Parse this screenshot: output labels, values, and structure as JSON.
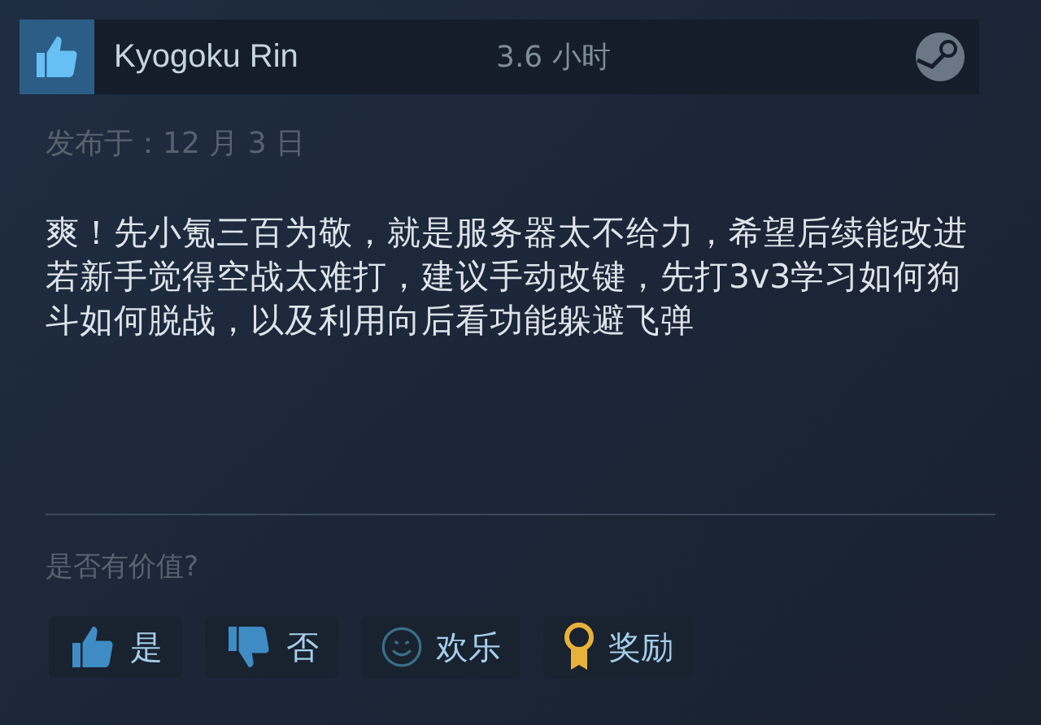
{
  "review": {
    "recommended": true,
    "author": "Kyogoku Rin",
    "playtime": "3.6 小时",
    "posted": "发布于：12 月 3 日",
    "paragraphs": [
      "爽！先小氪三百为敬，就是服务器太不给力，希望后续能改进",
      "若新手觉得空战太难打，建议手动改键，先打3v3学习如何狗斗如何脱战，以及利用向后看功能躲避飞弹"
    ]
  },
  "helpful": {
    "prompt": "是否有价值?",
    "buttons": [
      {
        "kind": "yes",
        "label": "是"
      },
      {
        "kind": "no",
        "label": "否"
      },
      {
        "kind": "funny",
        "label": "欢乐"
      },
      {
        "kind": "award",
        "label": "奖励"
      }
    ]
  }
}
